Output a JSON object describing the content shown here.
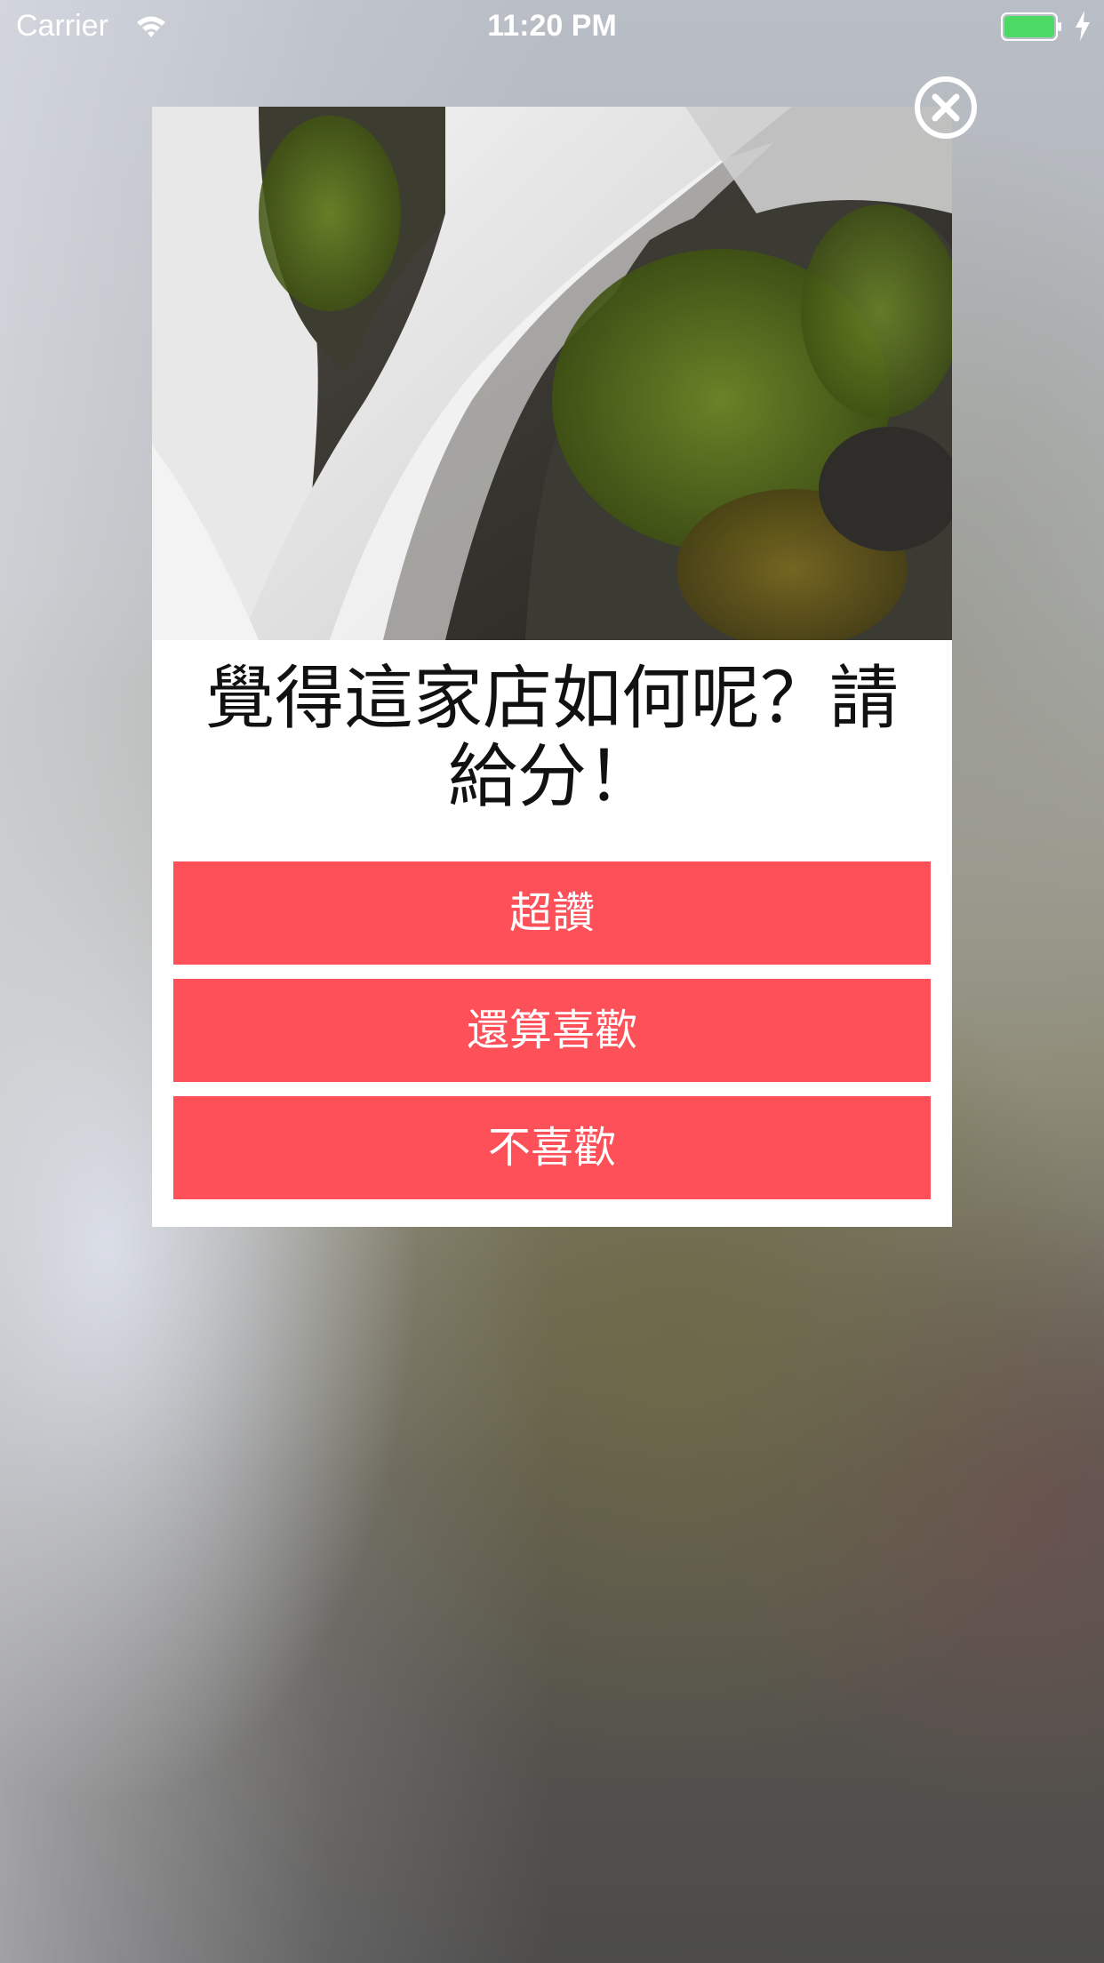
{
  "status_bar": {
    "carrier": "Carrier",
    "time": "11:20 PM",
    "battery_color": "#4cd964"
  },
  "dialog": {
    "image_icon": "waterfall-photo",
    "title": "覺得這家店如何呢？請給分！",
    "close_icon": "close-circle-icon",
    "buttons": [
      {
        "label": "超讚"
      },
      {
        "label": "還算喜歡"
      },
      {
        "label": "不喜歡"
      }
    ],
    "button_color": "#fe5059"
  }
}
